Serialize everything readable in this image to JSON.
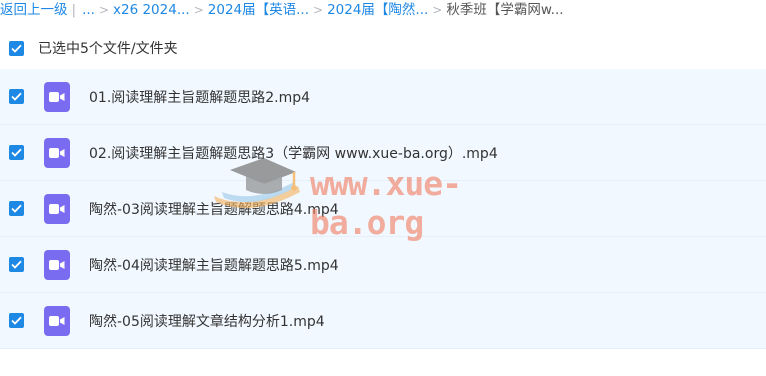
{
  "breadcrumb": {
    "back_label": "返回上一级",
    "pipe": "|",
    "ellipsis": "...",
    "items": [
      {
        "label": "x26 2024..."
      },
      {
        "label": "2024届【英语..."
      },
      {
        "label": "2024届【陶然..."
      }
    ],
    "current": "秋季班【学霸网w..."
  },
  "selection": {
    "label": "已选中5个文件/文件夹",
    "checked": true
  },
  "files": [
    {
      "name": "01.阅读理解主旨题解题思路2.mp4",
      "checked": true,
      "icon": "video-file-icon"
    },
    {
      "name": "02.阅读理解主旨题解题思路3（学霸网 www.xue-ba.org）.mp4",
      "checked": true,
      "icon": "video-file-icon"
    },
    {
      "name": "陶然-03阅读理解主旨题解题思路4.mp4",
      "checked": true,
      "icon": "video-file-icon"
    },
    {
      "name": "陶然-04阅读理解主旨题解题思路5.mp4",
      "checked": true,
      "icon": "video-file-icon"
    },
    {
      "name": "陶然-05阅读理解文章结构分析1.mp4",
      "checked": true,
      "icon": "video-file-icon"
    }
  ],
  "watermark": {
    "text": "www.xue-ba.org"
  },
  "colors": {
    "accent": "#1e88e5",
    "row_background": "#f1f8ff",
    "video_icon": "#7a6cf0",
    "watermark": "#f07a5c"
  }
}
